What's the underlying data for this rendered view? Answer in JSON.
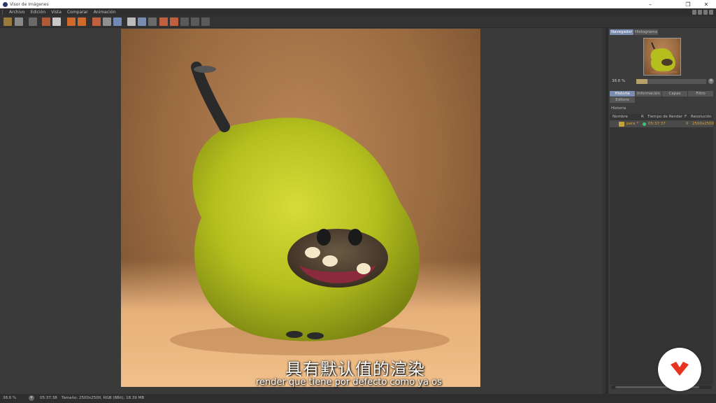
{
  "window": {
    "title": "Visor de Imágenes"
  },
  "menu": {
    "items": [
      "Archivo",
      "Edición",
      "Vista",
      "Comparar",
      "Animación"
    ]
  },
  "toolbar": {
    "icon_names": [
      "open-folder-icon",
      "save-icon",
      "export-icon",
      "film-icon",
      "cut-icon",
      "copy-icon",
      "paste-icon",
      "compare-a-icon",
      "compare-b-icon",
      "settings-icon",
      "ab-icon",
      "grid-view-icon",
      "layers-icon",
      "split-icon",
      "channel-icon",
      "frame-icon",
      "lut-icon",
      "filter-icon"
    ]
  },
  "navigator": {
    "tabs": [
      "Navegador",
      "Histograma"
    ],
    "zoom_label": "38.6 %",
    "zoom_fraction": 0.16,
    "zoom_button": "+"
  },
  "history": {
    "tabs": [
      "Historia",
      "Información",
      "Capas",
      "Filtro",
      "Editoro"
    ],
    "section_label": "Historia",
    "columns": [
      "Nombre",
      "R",
      "Tiempo de Render",
      "F",
      "Resolución"
    ],
    "rows": [
      {
        "name": "pera *",
        "time": "05:37:37",
        "frame": "0",
        "resolution": "2500x2500"
      }
    ]
  },
  "statusbar": {
    "zoom": "38.6 %",
    "zoom_button": "+",
    "time": "05:37:38",
    "info": "Tamaño: 2500x2500, RGB (8Bit), 18.39 MB"
  },
  "subtitles": {
    "chinese": "具有默认值的渲染",
    "spanish": "render que tiene por defecto como ya os"
  },
  "colors": {
    "accent": "#7a8cb0",
    "logo_red": "#e8331f",
    "history_text": "#e0a030"
  }
}
